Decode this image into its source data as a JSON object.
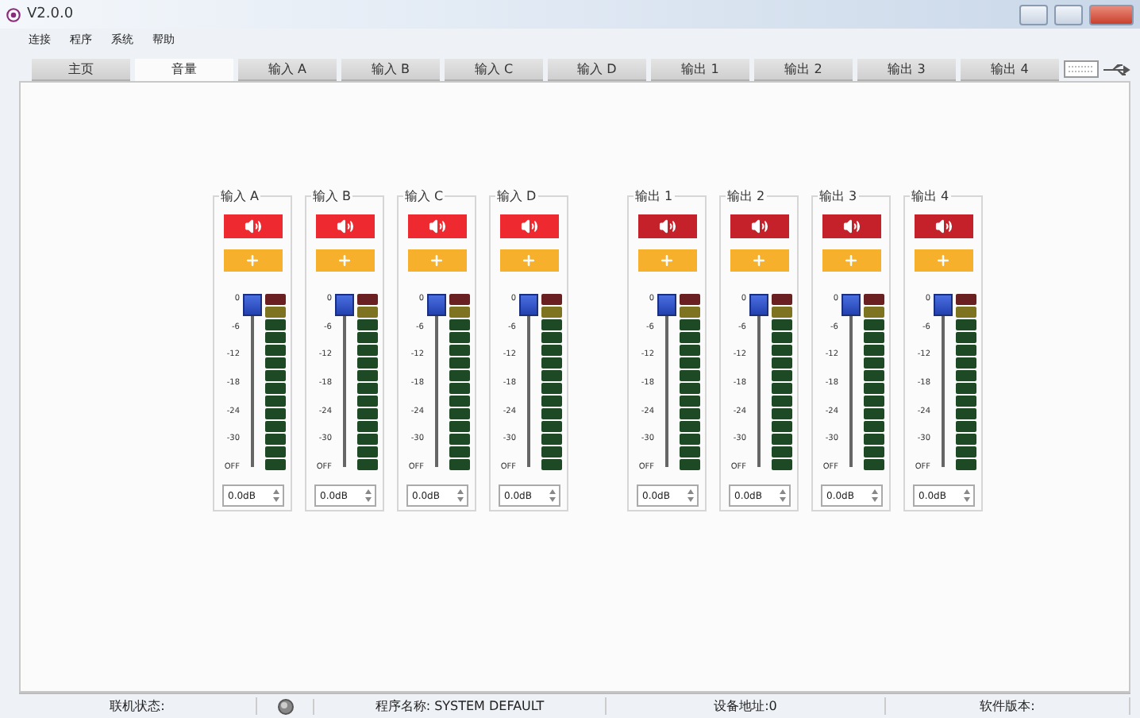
{
  "window": {
    "title": "V2.0.0"
  },
  "menu": [
    "连接",
    "程序",
    "系统",
    "帮助"
  ],
  "tabs": [
    {
      "label": "主页",
      "selected": false
    },
    {
      "label": "音量",
      "selected": true
    },
    {
      "label": "输入 A",
      "selected": false
    },
    {
      "label": "输入 B",
      "selected": false
    },
    {
      "label": "输入 C",
      "selected": false
    },
    {
      "label": "输入 D",
      "selected": false
    },
    {
      "label": "输出 1",
      "selected": false
    },
    {
      "label": "输出 2",
      "selected": false
    },
    {
      "label": "输出 3",
      "selected": false
    },
    {
      "label": "输出 4",
      "selected": false
    }
  ],
  "channel_groups": [
    {
      "kind": "input",
      "channels": [
        {
          "name": "输入 A",
          "level": 1,
          "scale": [
            "0",
            "-6",
            "-12",
            "-18",
            "-24",
            "-30",
            "OFF"
          ],
          "value": "0.0dB"
        },
        {
          "name": "输入 B",
          "level": 1,
          "scale": [
            "0",
            "-6",
            "-12",
            "-18",
            "-24",
            "-30",
            "OFF"
          ],
          "value": "0.0dB"
        },
        {
          "name": "输入 C",
          "level": 1,
          "scale": [
            "0",
            "-6",
            "-12",
            "-18",
            "-24",
            "-30",
            "OFF"
          ],
          "value": "0.0dB"
        },
        {
          "name": "输入 D",
          "level": 1,
          "scale": [
            "0",
            "-6",
            "-12",
            "-18",
            "-24",
            "-30",
            "OFF"
          ],
          "value": "0.0dB"
        }
      ]
    },
    {
      "kind": "output",
      "channels": [
        {
          "name": "输出 1",
          "level": 1,
          "scale": [
            "0",
            "-6",
            "-12",
            "-18",
            "-24",
            "-30",
            "OFF"
          ],
          "value": "0.0dB"
        },
        {
          "name": "输出 2",
          "level": 1,
          "scale": [
            "0",
            "-6",
            "-12",
            "-18",
            "-24",
            "-30",
            "OFF"
          ],
          "value": "0.0dB"
        },
        {
          "name": "输出 3",
          "level": 1,
          "scale": [
            "0",
            "-6",
            "-12",
            "-18",
            "-24",
            "-30",
            "OFF"
          ],
          "value": "0.0dB"
        },
        {
          "name": "输出 4",
          "level": 1,
          "scale": [
            "0",
            "-6",
            "-12",
            "-18",
            "-24",
            "-30",
            "OFF"
          ],
          "value": "0.0dB"
        }
      ]
    }
  ],
  "status_bar": {
    "connection_label": "联机状态:",
    "program": "程序名称: SYSTEM DEFAULT",
    "address": "设备地址:0",
    "version_label": "软件版本:"
  }
}
